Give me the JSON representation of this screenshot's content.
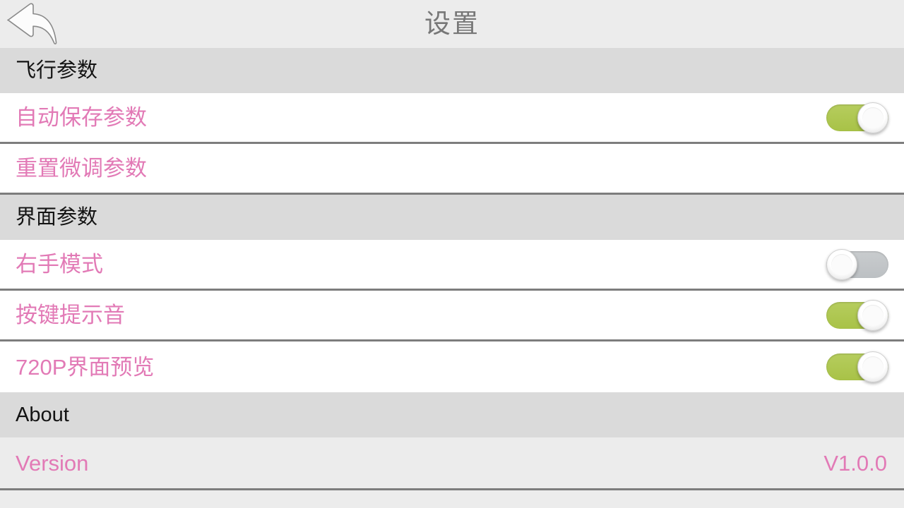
{
  "header": {
    "title": "设置",
    "back_icon": "back-arrow-icon"
  },
  "sections": [
    {
      "id": "flight",
      "header": "飞行参数",
      "rows": [
        {
          "id": "auto-save-params",
          "label": "自动保存参数",
          "control": "toggle",
          "state": "on"
        },
        {
          "id": "reset-trim-params",
          "label": "重置微调参数",
          "control": "none",
          "state": ""
        }
      ]
    },
    {
      "id": "interface",
      "header": "界面参数",
      "rows": [
        {
          "id": "right-hand-mode",
          "label": "右手模式",
          "control": "toggle",
          "state": "off"
        },
        {
          "id": "key-tone",
          "label": "按键提示音",
          "control": "toggle",
          "state": "on"
        },
        {
          "id": "preview-720p",
          "label": "720P界面预览",
          "control": "toggle",
          "state": "on"
        }
      ]
    },
    {
      "id": "about",
      "header": "About",
      "rows": [
        {
          "id": "version",
          "label": "Version",
          "control": "value",
          "value": "V1.0.0"
        }
      ]
    }
  ],
  "colors": {
    "accent_pink": "#e27ab6",
    "toggle_on": "#b0ca52",
    "toggle_off": "#c2c6c9",
    "section_header_bg": "#dadada",
    "page_bg": "#ececec",
    "row_bg": "#ffffff",
    "separator": "#7d7d7d",
    "title_text": "#777777",
    "section_text": "#131313"
  }
}
